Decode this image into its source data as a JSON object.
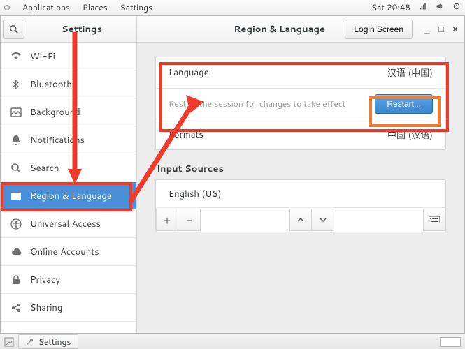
{
  "os_panel": {
    "menus": [
      "Applications",
      "Places",
      "Settings"
    ],
    "clock": "Sat 20:48"
  },
  "sidebar": {
    "title": "Settings",
    "items": [
      {
        "label": "Wi-Fi",
        "icon": "wifi"
      },
      {
        "label": "Bluetooth",
        "icon": "bluetooth"
      },
      {
        "label": "Background",
        "icon": "background"
      },
      {
        "label": "Notifications",
        "icon": "notifications"
      },
      {
        "label": "Search",
        "icon": "search"
      },
      {
        "label": "Region & Language",
        "icon": "region",
        "active": true
      },
      {
        "label": "Universal Access",
        "icon": "universal"
      },
      {
        "label": "Online Accounts",
        "icon": "online"
      },
      {
        "label": "Privacy",
        "icon": "privacy"
      },
      {
        "label": "Sharing",
        "icon": "sharing"
      }
    ]
  },
  "content": {
    "header_title": "Region & Language",
    "login_screen_button": "Login Screen",
    "language": {
      "label": "Language",
      "value": "汉语 (中国)",
      "restart_hint": "Restart the session for changes to take effect",
      "restart_button": "Restart..."
    },
    "formats": {
      "label": "Formats",
      "value": "中国 (汉语)"
    },
    "input_sources": {
      "title": "Input Sources",
      "items": [
        "English (US)"
      ]
    }
  },
  "taskbar": {
    "app_label": "Settings"
  }
}
